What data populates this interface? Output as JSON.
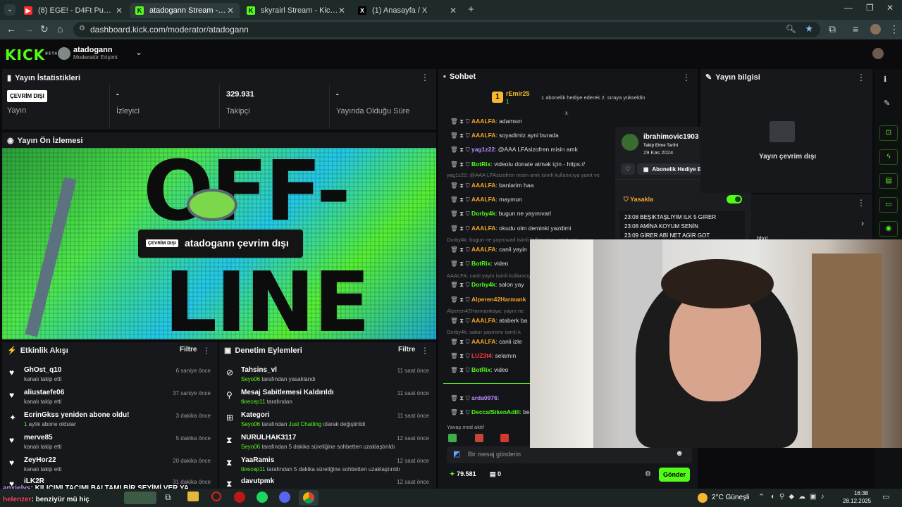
{
  "browser": {
    "tabs": [
      {
        "title": "(8) EGE! - D4Ft Punk [Official Ly",
        "active": false
      },
      {
        "title": "atadogann Stream - Kick Dashb",
        "active": true
      },
      {
        "title": "skyrairl Stream - Kick Dashboa",
        "active": false
      },
      {
        "title": "(1) Anasayfa / X",
        "active": false
      }
    ],
    "url": "dashboard.kick.com/moderator/atadogann"
  },
  "header": {
    "logo": "KICK",
    "logo_badge": "BETA",
    "channel": "atadogann",
    "role": "Moderatör Erişimi"
  },
  "stats": {
    "title": "Yayın İstatistikleri",
    "items": [
      {
        "value": "ÇEVRİM DIŞI",
        "label": "Yayın"
      },
      {
        "value": "-",
        "label": "İzleyici"
      },
      {
        "value": "329.931",
        "label": "Takipçi"
      },
      {
        "value": "-",
        "label": "Yayında Olduğu Süre"
      }
    ]
  },
  "preview": {
    "title": "Yayın Ön İzlemesi",
    "badge": "ÇEVRİM DIŞI",
    "status": "atadogann çevrim dışı",
    "big1": "OFF-",
    "big2": "LINE"
  },
  "activity": {
    "title": "Etkinlik Akışı",
    "filter": "Filtre",
    "items": [
      {
        "name": "GhOst_q10",
        "desc": "kanalı takip etti",
        "time": "6 saniye önce"
      },
      {
        "name": "aliustaefe06",
        "desc": "kanalı takip etti",
        "time": "37 saniye önce"
      },
      {
        "name": "EcrinGkss yeniden abone oldu!",
        "desc_prefix": "1",
        "desc": " aylık abone oldular",
        "time": "3 dakika önce"
      },
      {
        "name": "merve85",
        "desc": "kanalı takip etti",
        "time": "5 dakika önce"
      },
      {
        "name": "ZeyHor22",
        "desc": "kanalı takip etti",
        "time": "20 dakika önce"
      },
      {
        "name": "iLK2R",
        "desc": "",
        "time": "31 dakika önce"
      }
    ]
  },
  "moderation": {
    "title": "Denetim Eylemleri",
    "filter": "Filtre",
    "items": [
      {
        "name": "Tahsins_vl",
        "by": "Seyo06",
        "desc": " tarafından yasaklandı",
        "extra": "",
        "extra2": "",
        "time": "11 saat önce"
      },
      {
        "name": "Mesaj Sabitlemesi Kaldırıldı",
        "by": "tkrecep11",
        "desc": " tarafından",
        "extra": "",
        "extra2": "",
        "time": "11 saat önce"
      },
      {
        "name": "Kategori",
        "by": "Seyo06",
        "desc": " tarafından ",
        "extra": "Just Chatting",
        "extra2": " olarak değiştirildi",
        "time": "11 saat önce"
      },
      {
        "name": "NURULHAK3117",
        "by": "Seyo06",
        "desc": " tarafından 5 dakika süreliğine sohbetten uzaklaştırıldı",
        "extra": "",
        "extra2": "",
        "time": "12 saat önce"
      },
      {
        "name": "YaaRamis",
        "by": "tkrecep11",
        "desc": " tarafından 5 dakika süreliğine sohbetten uzaklaştırıldı",
        "extra": "",
        "extra2": "",
        "time": "12 saat önce"
      },
      {
        "name": "davutpmk",
        "by": "",
        "desc": "",
        "extra": "",
        "extra2": "",
        "time": "12 saat önce"
      }
    ]
  },
  "chat": {
    "title": "Sohbet",
    "top_user": "rEmir25",
    "top_count": "1",
    "top_text": "1 abonelik hediye ederek 2. sıraya yükseldin",
    "messages": [
      {
        "user": "AAALFA",
        "color": "#f5a623",
        "text": ": adamsın"
      },
      {
        "user": "AAALFA",
        "color": "#f5a623",
        "text": ": soyadimiz ayni burada"
      },
      {
        "user": "yag1z22",
        "color": "#b98cff",
        "text": ": @AAA LFAsizofren misin amk"
      },
      {
        "user": "BotRix",
        "color": "#53fc18",
        "text": ": videolu donate atmak için - https://"
      },
      {
        "user": "AAALFA",
        "color": "#f5a623",
        "text": ": banlarim haa"
      },
      {
        "user": "AAALFA",
        "color": "#f5a623",
        "text": ": maymun"
      },
      {
        "user": "Dorby4k",
        "color": "#53fc18",
        "text": ": bugun ne yayınıvarl"
      },
      {
        "user": "AAALFA",
        "color": "#f5a623",
        "text": ": okudu olm deminki yazdimi"
      },
      {
        "user": "AAALFA",
        "color": "#f5a623",
        "text": ": canli yayin"
      },
      {
        "user": "BotRix",
        "color": "#53fc18",
        "text": ": video"
      },
      {
        "user": "Dorby4k",
        "color": "#53fc18",
        "text": ": salon yay"
      },
      {
        "user": "Alperen42Harmank",
        "color": "#f5a623",
        "text": ""
      },
      {
        "user": "AAALFA",
        "color": "#f5a623",
        "text": ": ataberk ba"
      },
      {
        "user": "AAALFA",
        "color": "#f5a623",
        "text": ": canli izle"
      },
      {
        "user": "LUZ3t4",
        "color": "#ff3b3b",
        "text": ": selamın"
      },
      {
        "user": "BotRix",
        "color": "#53fc18",
        "text": ": video"
      },
      {
        "user": "arda0976",
        "color": "#b98cff",
        "text": ":"
      },
      {
        "user": "DeccalSikenAdill",
        "color": "#53fc18",
        "text": ": be"
      }
    ],
    "replies": [
      "yag1z22: @AAA LFAsizofren misin amk isimli kullanıcıya yanıt ve",
      "Dorby4k: bugun ne yayınıvarl isimli kullanıcıya yanıt ver",
      "AAALFA: canli yayin isimli kullanıcıya yanıt",
      "Alperen42Harmankaya: yayın ne",
      "Dorby4k: salon yayınımı isimli k"
    ],
    "slow_mode": "Yavaş mod aktif",
    "input_placeholder": "Bir mesaj gönderin",
    "points": "79.581",
    "gifts": "0",
    "send": "Gönder"
  },
  "user_card": {
    "username": "ibrahimovic1903",
    "follow_label": "Takip Etme Tarihi",
    "follow_date": "29 Kas 2024",
    "gift_button": "Abonelik Hediye Edin",
    "ban_label": "Yasakla",
    "history": [
      "23:08 BEŞIKTAŞLIYIM ILK 5 GIRER",
      "23:08 AMİNA KOYUM SENİN",
      "23:09 GİRER ABİ NET AGİR GOT"
    ]
  },
  "stream_info": {
    "title": "Yayın bilgisi",
    "offline": "Yayın çevrim dışı",
    "bot_fragment": "bbot"
  },
  "overlay_chat": [
    {
      "user": "anxielys",
      "text": ": KILICIMI TACIMI BALTAMI BİR SEYİMİ VER YA"
    },
    {
      "user": "helenzer",
      "text": ": benziyür mü hiç"
    }
  ],
  "taskbar": {
    "weather": "2°C",
    "weather_desc": "Güneşli",
    "time": "16:38",
    "date": "28.12.2025"
  },
  "colors": {
    "kick_green": "#53fc18",
    "panel_bg": "#17181b",
    "page_bg": "#0b0b0d"
  }
}
